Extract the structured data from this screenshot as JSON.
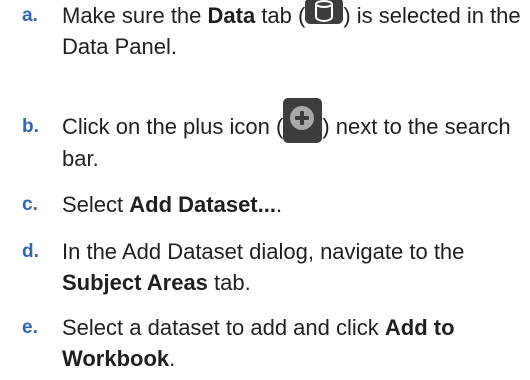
{
  "steps": [
    {
      "marker": "a.",
      "before": "Make sure the ",
      "bold": "Data",
      "after_bold": " tab (",
      "icon": "database-icon",
      "after_icon": ") is selected in the Data Panel."
    },
    {
      "marker": "b.",
      "before": "Click on the plus icon (",
      "icon": "plus-circle-icon",
      "after_icon": ") next to the search bar."
    },
    {
      "marker": "c.",
      "before": "Select ",
      "bold": "Add Dataset...",
      "after": "."
    },
    {
      "marker": "d.",
      "before": "In the Add Dataset dialog, navigate to the ",
      "bold": "Subject Areas",
      "after": " tab."
    },
    {
      "marker": "e.",
      "before": "Select a dataset to add and click ",
      "bold": "Add to Workbook",
      "after": "."
    }
  ],
  "colors": {
    "marker": "#2f67b0",
    "text": "#1f1f1f",
    "icon_background": "#3d3d3d",
    "plus_circle": "#a9a9a9"
  }
}
